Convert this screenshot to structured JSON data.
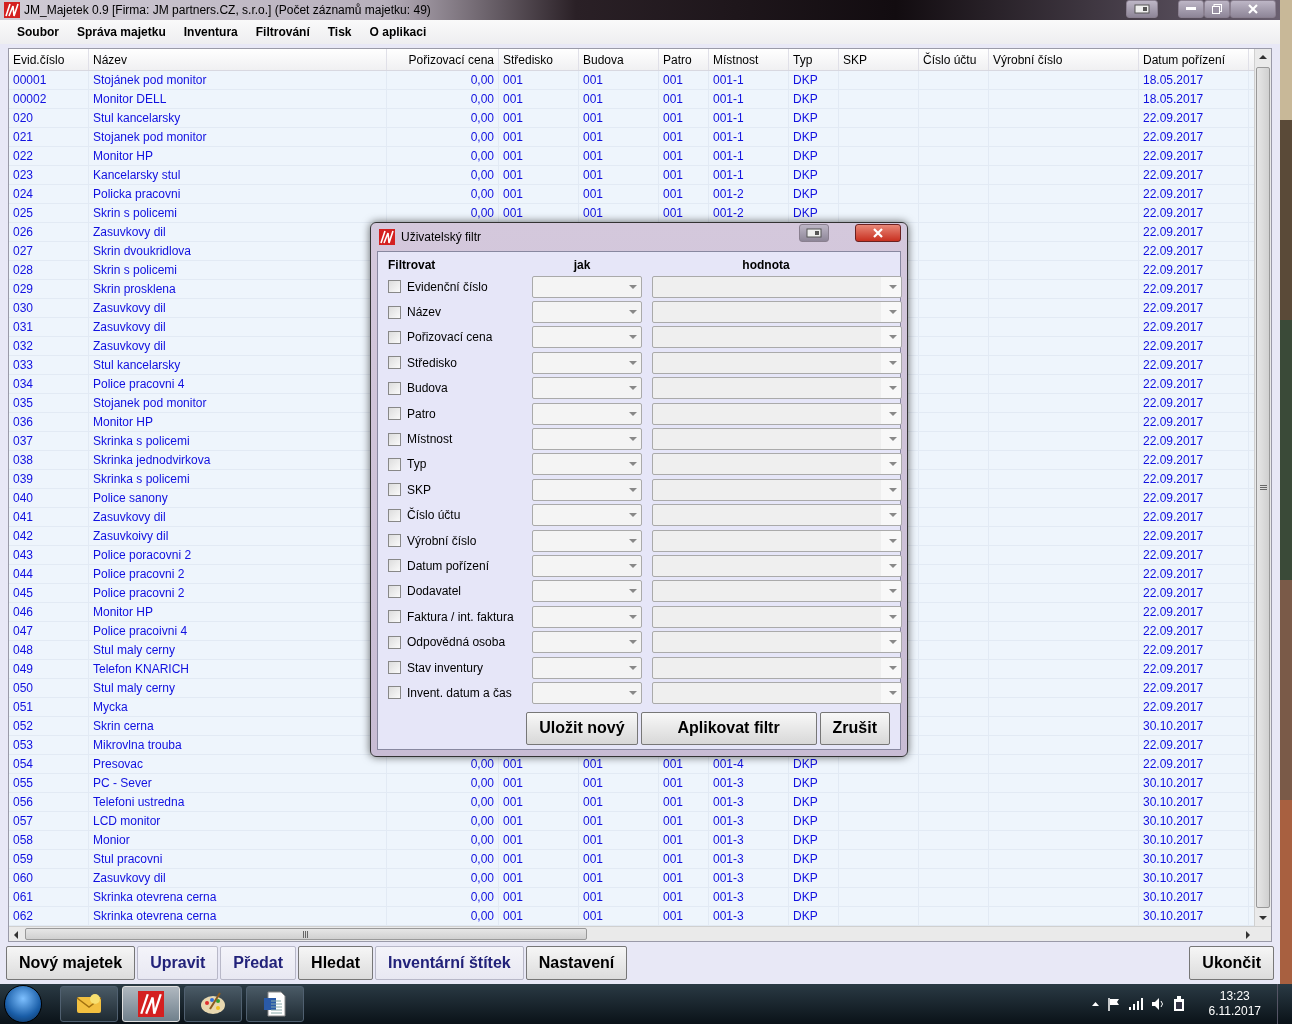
{
  "window": {
    "title": "JM_Majetek 0.9 [Firma: JM partners.CZ, s.r.o.]  (Počet záznamů majetku: 49)"
  },
  "menu": [
    "Soubor",
    "Správa majetku",
    "Inventura",
    "Filtrování",
    "Tisk",
    "O aplikaci"
  ],
  "table": {
    "columns": [
      "Evid.číslo",
      "Název",
      "Pořizovací cena",
      "Středisko",
      "Budova",
      "Patro",
      "Místnost",
      "Typ",
      "SKP",
      "Číslo účtu",
      "Výrobní číslo",
      "Datum pořízení"
    ],
    "rows": [
      {
        "evid": "00001",
        "nazev": "Stojánek pod monitor",
        "cena": "0,00",
        "stredisko": "001",
        "budova": "001",
        "patro": "001",
        "mistnost": "001-1",
        "typ": "DKP",
        "datum": "18.05.2017"
      },
      {
        "evid": "00002",
        "nazev": "Monitor DELL",
        "cena": "0,00",
        "stredisko": "001",
        "budova": "001",
        "patro": "001",
        "mistnost": "001-1",
        "typ": "DKP",
        "datum": "18.05.2017"
      },
      {
        "evid": "020",
        "nazev": "Stul kancelarsky",
        "cena": "0,00",
        "stredisko": "001",
        "budova": "001",
        "patro": "001",
        "mistnost": "001-1",
        "typ": "DKP",
        "datum": "22.09.2017"
      },
      {
        "evid": "021",
        "nazev": "Stojanek pod monitor",
        "cena": "0,00",
        "stredisko": "001",
        "budova": "001",
        "patro": "001",
        "mistnost": "001-1",
        "typ": "DKP",
        "datum": "22.09.2017"
      },
      {
        "evid": "022",
        "nazev": "Monitor HP",
        "cena": "0,00",
        "stredisko": "001",
        "budova": "001",
        "patro": "001",
        "mistnost": "001-1",
        "typ": "DKP",
        "datum": "22.09.2017"
      },
      {
        "evid": "023",
        "nazev": "Kancelarsky stul",
        "cena": "0,00",
        "stredisko": "001",
        "budova": "001",
        "patro": "001",
        "mistnost": "001-1",
        "typ": "DKP",
        "datum": "22.09.2017"
      },
      {
        "evid": "024",
        "nazev": "Policka pracovni",
        "cena": "0,00",
        "stredisko": "001",
        "budova": "001",
        "patro": "001",
        "mistnost": "001-2",
        "typ": "DKP",
        "datum": "22.09.2017"
      },
      {
        "evid": "025",
        "nazev": "Skrin s policemi",
        "cena": "0,00",
        "stredisko": "001",
        "budova": "001",
        "patro": "001",
        "mistnost": "001-2",
        "typ": "DKP",
        "datum": "22.09.2017"
      },
      {
        "evid": "026",
        "nazev": "Zasuvkovy dil",
        "datum": "22.09.2017"
      },
      {
        "evid": "027",
        "nazev": "Skrin dvoukridlova",
        "datum": "22.09.2017"
      },
      {
        "evid": "028",
        "nazev": "Skrin s policemi",
        "datum": "22.09.2017"
      },
      {
        "evid": "029",
        "nazev": "Skrin prosklena",
        "datum": "22.09.2017"
      },
      {
        "evid": "030",
        "nazev": "Zasuvkovy dil",
        "datum": "22.09.2017"
      },
      {
        "evid": "031",
        "nazev": "Zasuvkovy dil",
        "datum": "22.09.2017"
      },
      {
        "evid": "032",
        "nazev": "Zasuvkovy dil",
        "datum": "22.09.2017"
      },
      {
        "evid": "033",
        "nazev": "Stul kancelarsky",
        "datum": "22.09.2017"
      },
      {
        "evid": "034",
        "nazev": "Police pracovni 4",
        "datum": "22.09.2017"
      },
      {
        "evid": "035",
        "nazev": "Stojanek pod monitor",
        "datum": "22.09.2017"
      },
      {
        "evid": "036",
        "nazev": "Monitor HP",
        "datum": "22.09.2017"
      },
      {
        "evid": "037",
        "nazev": "Skrinka s policemi",
        "datum": "22.09.2017"
      },
      {
        "evid": "038",
        "nazev": "Skrinka jednodvirkova",
        "datum": "22.09.2017"
      },
      {
        "evid": "039",
        "nazev": "Skrinka s policemi",
        "datum": "22.09.2017"
      },
      {
        "evid": "040",
        "nazev": "Police sanony",
        "datum": "22.09.2017"
      },
      {
        "evid": "041",
        "nazev": "Zasuvkovy dil",
        "datum": "22.09.2017"
      },
      {
        "evid": "042",
        "nazev": "Zasuvkoivy dil",
        "datum": "22.09.2017"
      },
      {
        "evid": "043",
        "nazev": "Police poracovni 2",
        "datum": "22.09.2017"
      },
      {
        "evid": "044",
        "nazev": "Police pracovni 2",
        "datum": "22.09.2017"
      },
      {
        "evid": "045",
        "nazev": "Police pracovni 2",
        "datum": "22.09.2017"
      },
      {
        "evid": "046",
        "nazev": "Monitor HP",
        "datum": "22.09.2017"
      },
      {
        "evid": "047",
        "nazev": "Police pracoivni 4",
        "datum": "22.09.2017"
      },
      {
        "evid": "048",
        "nazev": "Stul maly cerny",
        "datum": "22.09.2017"
      },
      {
        "evid": "049",
        "nazev": "Telefon KNARICH",
        "datum": "22.09.2017"
      },
      {
        "evid": "050",
        "nazev": "Stul maly cerny",
        "datum": "22.09.2017"
      },
      {
        "evid": "051",
        "nazev": "Mycka",
        "datum": "22.09.2017"
      },
      {
        "evid": "052",
        "nazev": "Skrin cerna",
        "datum": "30.10.2017"
      },
      {
        "evid": "053",
        "nazev": "Mikrovlna trouba",
        "datum": "22.09.2017"
      },
      {
        "evid": "054",
        "nazev": "Presovac",
        "cena": "0,00",
        "stredisko": "001",
        "budova": "001",
        "patro": "001",
        "mistnost": "001-4",
        "typ": "DKP",
        "datum": "22.09.2017"
      },
      {
        "evid": "055",
        "nazev": "PC - Sever",
        "cena": "0,00",
        "stredisko": "001",
        "budova": "001",
        "patro": "001",
        "mistnost": "001-3",
        "typ": "DKP",
        "datum": "30.10.2017"
      },
      {
        "evid": "056",
        "nazev": "Telefoni ustredna",
        "cena": "0,00",
        "stredisko": "001",
        "budova": "001",
        "patro": "001",
        "mistnost": "001-3",
        "typ": "DKP",
        "datum": "30.10.2017"
      },
      {
        "evid": "057",
        "nazev": "LCD monitor",
        "cena": "0,00",
        "stredisko": "001",
        "budova": "001",
        "patro": "001",
        "mistnost": "001-3",
        "typ": "DKP",
        "datum": "30.10.2017"
      },
      {
        "evid": "058",
        "nazev": "Monior",
        "cena": "0,00",
        "stredisko": "001",
        "budova": "001",
        "patro": "001",
        "mistnost": "001-3",
        "typ": "DKP",
        "datum": "30.10.2017"
      },
      {
        "evid": "059",
        "nazev": "Stul pracovni",
        "cena": "0,00",
        "stredisko": "001",
        "budova": "001",
        "patro": "001",
        "mistnost": "001-3",
        "typ": "DKP",
        "datum": "30.10.2017"
      },
      {
        "evid": "060",
        "nazev": "Zasuvkovy dil",
        "cena": "0,00",
        "stredisko": "001",
        "budova": "001",
        "patro": "001",
        "mistnost": "001-3",
        "typ": "DKP",
        "datum": "30.10.2017"
      },
      {
        "evid": "061",
        "nazev": "Skrinka otevrena cerna",
        "cena": "0,00",
        "stredisko": "001",
        "budova": "001",
        "patro": "001",
        "mistnost": "001-3",
        "typ": "DKP",
        "datum": "30.10.2017"
      },
      {
        "evid": "062",
        "nazev": "Skrinka otevrena cerna",
        "cena": "0,00",
        "stredisko": "001",
        "budova": "001",
        "patro": "001",
        "mistnost": "001-3",
        "typ": "DKP",
        "datum": "30.10.2017"
      }
    ]
  },
  "buttons": [
    {
      "label": "Nový majetek",
      "kind": "plain"
    },
    {
      "label": "Upravit",
      "kind": "accent"
    },
    {
      "label": "Předat",
      "kind": "accent"
    },
    {
      "label": "Hledat",
      "kind": "plain"
    },
    {
      "label": "Inventární štítek",
      "kind": "accent"
    },
    {
      "label": "Nastavení",
      "kind": "plain"
    }
  ],
  "exit_button": "Ukončit",
  "dialog": {
    "title": "Uživatelský filtr",
    "headers": [
      "Filtrovat",
      "jak",
      "hodnota"
    ],
    "filters": [
      {
        "label": "Evidenční číslo",
        "checked": false
      },
      {
        "label": "Název",
        "checked": false
      },
      {
        "label": "Pořizovací cena",
        "checked": false
      },
      {
        "label": "Středisko",
        "checked": false
      },
      {
        "label": "Budova",
        "checked": false
      },
      {
        "label": "Patro",
        "checked": false
      },
      {
        "label": "Místnost",
        "checked": false
      },
      {
        "label": "Typ",
        "checked": false
      },
      {
        "label": "SKP",
        "checked": false
      },
      {
        "label": "Číslo účtu",
        "checked": false
      },
      {
        "label": "Výrobní číslo",
        "checked": false
      },
      {
        "label": "Datum pořízení",
        "checked": false
      },
      {
        "label": "Dodavatel",
        "checked": false
      },
      {
        "label": "Faktura / int. faktura",
        "checked": false
      },
      {
        "label": "Odpovědná osoba",
        "checked": false
      },
      {
        "label": "Stav inventury",
        "checked": false
      },
      {
        "label": "Invent. datum a čas",
        "checked": false
      }
    ],
    "buttons": [
      "Uložit nový",
      "Aplikovat filtr",
      "Zrušit"
    ]
  },
  "taskbar": {
    "apps": [
      {
        "kind": "mail",
        "selected": false
      },
      {
        "kind": "logo",
        "selected": true
      },
      {
        "kind": "paint",
        "selected": false
      },
      {
        "kind": "document",
        "selected": false
      }
    ],
    "time": "13:23",
    "date": "6.11.2017"
  }
}
